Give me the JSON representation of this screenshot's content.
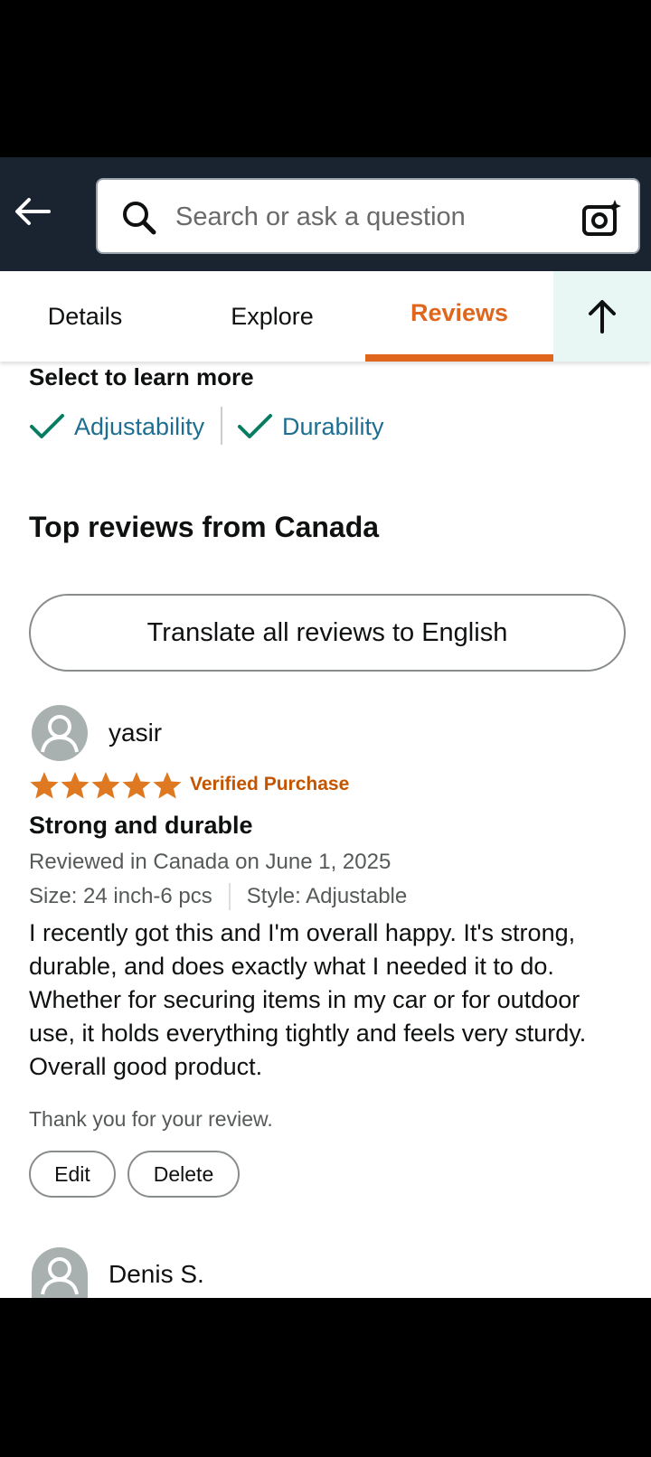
{
  "search": {
    "placeholder": "Search or ask a question"
  },
  "tabs": [
    {
      "label": "Details"
    },
    {
      "label": "Explore"
    },
    {
      "label": "Reviews",
      "active": true
    }
  ],
  "learn_more": {
    "title": "Select to learn more",
    "chips": [
      "Adjustability",
      "Durability"
    ]
  },
  "section_title": "Top reviews from Canada",
  "translate_label": "Translate all reviews to English",
  "reviews": [
    {
      "name": "yasir",
      "rating": 5,
      "verified": "Verified Purchase",
      "title": "Strong and durable",
      "meta": "Reviewed in Canada on June 1, 2025",
      "size": "Size: 24 inch-6 pcs",
      "style": "Style: Adjustable",
      "body": "I recently got this and I'm overall happy. It's strong, durable, and does exactly what I needed it to do. Whether for securing items in my car or for outdoor use, it holds everything tightly and feels very sturdy. Overall good product.",
      "thanks": "Thank you for your review.",
      "edit_label": "Edit",
      "delete_label": "Delete"
    },
    {
      "name": "Denis S."
    }
  ],
  "colors": {
    "accent": "#e0651d",
    "star": "#de7921",
    "link": "#1e6e91",
    "check": "#067d62",
    "header_bg": "#1a2330"
  }
}
